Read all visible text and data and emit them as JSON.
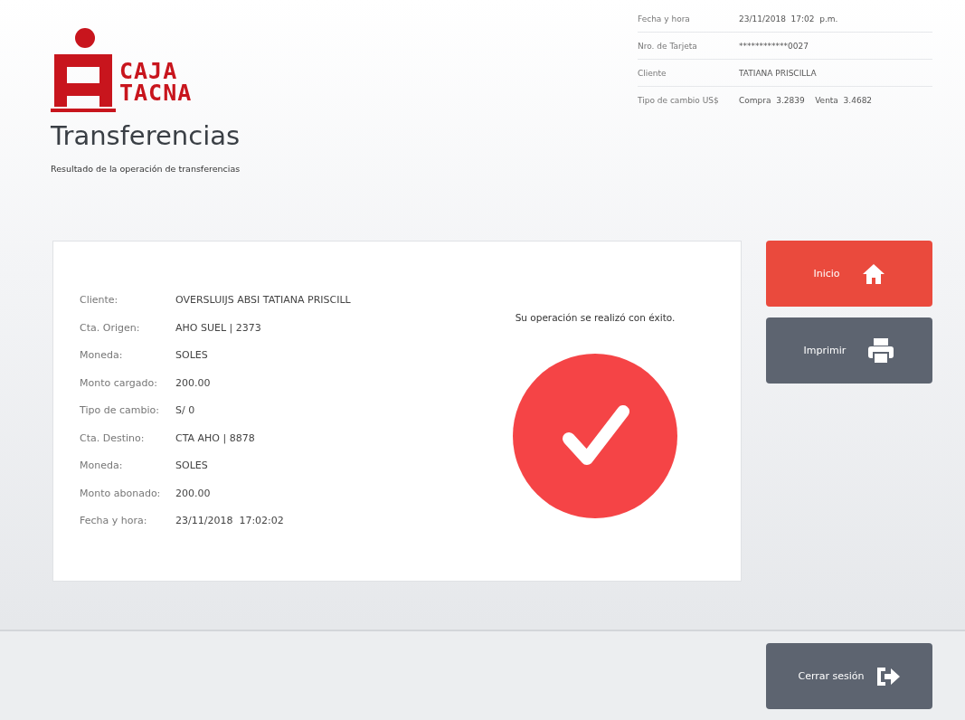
{
  "logo": {
    "lines": [
      "CAJA",
      "TACNA"
    ]
  },
  "session_info": [
    {
      "label": "Fecha y hora",
      "value": "23/11/2018  17:02  p.m."
    },
    {
      "label": "Nro. de Tarjeta",
      "value": "************0027"
    },
    {
      "label": "Cliente",
      "value": "TATIANA PRISCILLA"
    },
    {
      "label": "Tipo de cambio US$",
      "value": "Compra  3.2839    Venta  3.4682"
    }
  ],
  "page": {
    "title": "Transferencias",
    "subtitle": "Resultado de la operación de transferencias"
  },
  "details": [
    {
      "label": "Cliente:",
      "value": "OVERSLUIJS ABSI TATIANA PRISCILL"
    },
    {
      "label": "Cta. Origen:",
      "value": "AHO SUEL | 2373"
    },
    {
      "label": "Moneda:",
      "value": "SOLES"
    },
    {
      "label": "Monto cargado:",
      "value": "200.00"
    },
    {
      "label": "Tipo de cambio:",
      "value": "S/ 0"
    },
    {
      "label": "Cta. Destino:",
      "value": "CTA AHO | 8878"
    },
    {
      "label": "Moneda:",
      "value": "SOLES"
    },
    {
      "label": "Monto abonado:",
      "value": "200.00"
    },
    {
      "label": "Fecha y hora:",
      "value": "23/11/2018  17:02:02"
    }
  ],
  "result": {
    "message": "Su operación se realizó con éxito."
  },
  "actions": [
    {
      "label": "Inicio",
      "kind": "home"
    },
    {
      "label": "Imprimir",
      "kind": "print"
    }
  ],
  "footer": {
    "button": {
      "label": "Cerrar sesión",
      "kind": "logout"
    }
  }
}
